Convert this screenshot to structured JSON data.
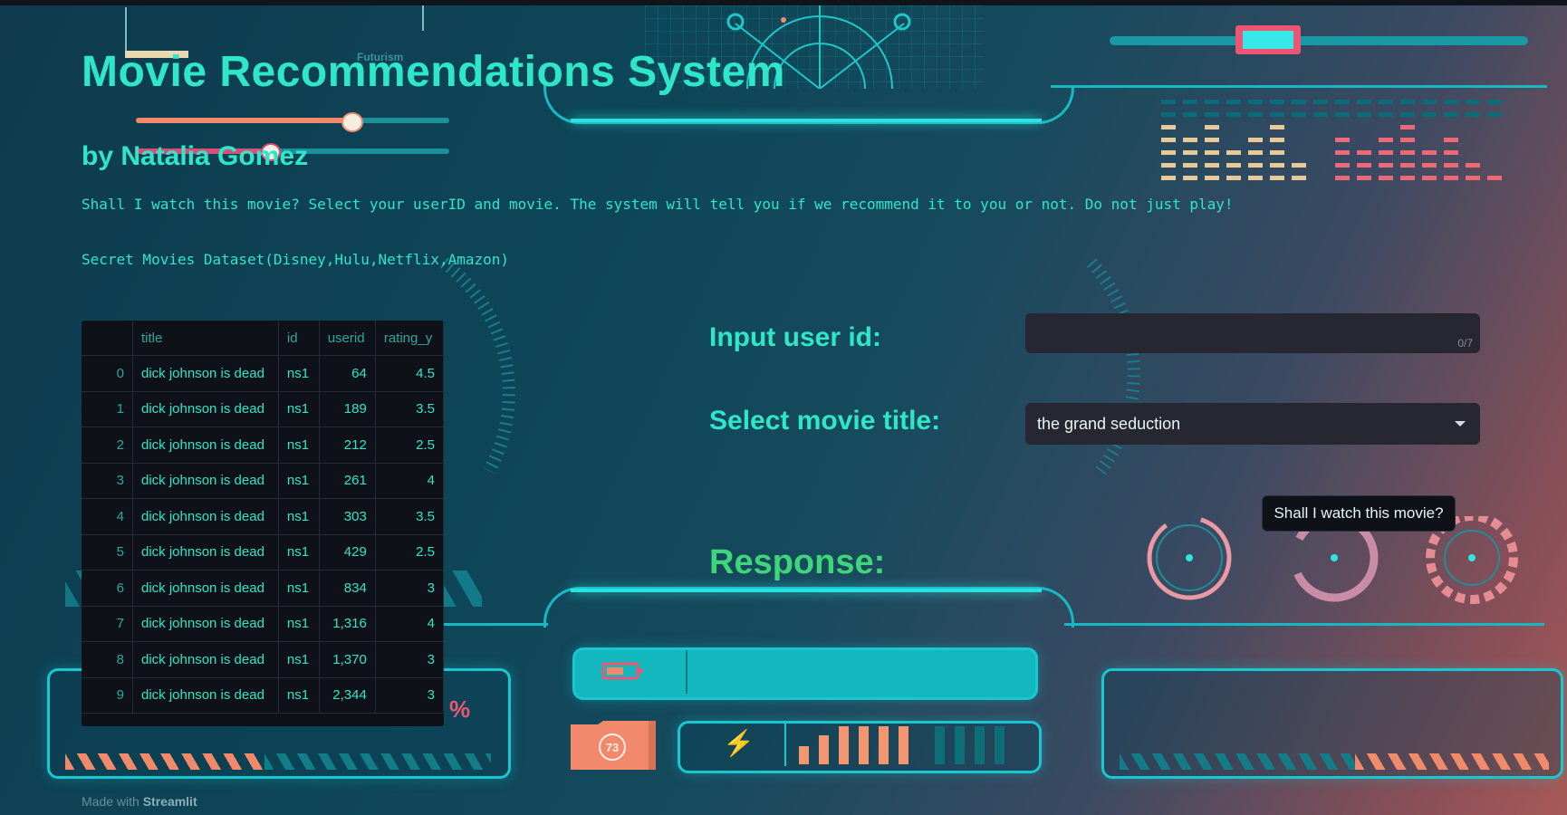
{
  "app": {
    "title": "Movie Recommendations System",
    "byline": "by Natalia Gomez",
    "intro": "Shall I watch this movie? Select your userID and movie. The system will tell you if we recommend it to you or not. Do not just play!",
    "dataset_caption": "Secret Movies Dataset(Disney,Hulu,Netflix,Amazon)"
  },
  "table": {
    "columns": [
      "",
      "title",
      "id",
      "userid",
      "rating_y"
    ],
    "rows": [
      {
        "index": "0",
        "title": "dick johnson is dead",
        "id": "ns1",
        "userid": "64",
        "rating": "4.5"
      },
      {
        "index": "1",
        "title": "dick johnson is dead",
        "id": "ns1",
        "userid": "189",
        "rating": "3.5"
      },
      {
        "index": "2",
        "title": "dick johnson is dead",
        "id": "ns1",
        "userid": "212",
        "rating": "2.5"
      },
      {
        "index": "3",
        "title": "dick johnson is dead",
        "id": "ns1",
        "userid": "261",
        "rating": "4"
      },
      {
        "index": "4",
        "title": "dick johnson is dead",
        "id": "ns1",
        "userid": "303",
        "rating": "3.5"
      },
      {
        "index": "5",
        "title": "dick johnson is dead",
        "id": "ns1",
        "userid": "429",
        "rating": "2.5"
      },
      {
        "index": "6",
        "title": "dick johnson is dead",
        "id": "ns1",
        "userid": "834",
        "rating": "3"
      },
      {
        "index": "7",
        "title": "dick johnson is dead",
        "id": "ns1",
        "userid": "1,316",
        "rating": "4"
      },
      {
        "index": "8",
        "title": "dick johnson is dead",
        "id": "ns1",
        "userid": "1,370",
        "rating": "3"
      },
      {
        "index": "9",
        "title": "dick johnson is dead",
        "id": "ns1",
        "userid": "2,344",
        "rating": "3"
      }
    ]
  },
  "form": {
    "user_label": "Input user id:",
    "user_value": "",
    "user_counter": "0/7",
    "movie_label": "Select movie title:",
    "movie_selected": "the grand seduction",
    "submit_label": "Shall I watch this movie?",
    "response_label": "Response:"
  },
  "footer": {
    "made_with": "Made with",
    "brand": "Streamlit"
  },
  "background": {
    "futurism_text": "Futurism",
    "battery_value": "73",
    "percent_symbol": "%",
    "bolt_glyph": "⚡"
  },
  "colors": {
    "accent": "#2ee6c8",
    "response": "#3fd57a",
    "hud_cyan": "#18c7cf",
    "hud_coral": "#f08a6a"
  }
}
